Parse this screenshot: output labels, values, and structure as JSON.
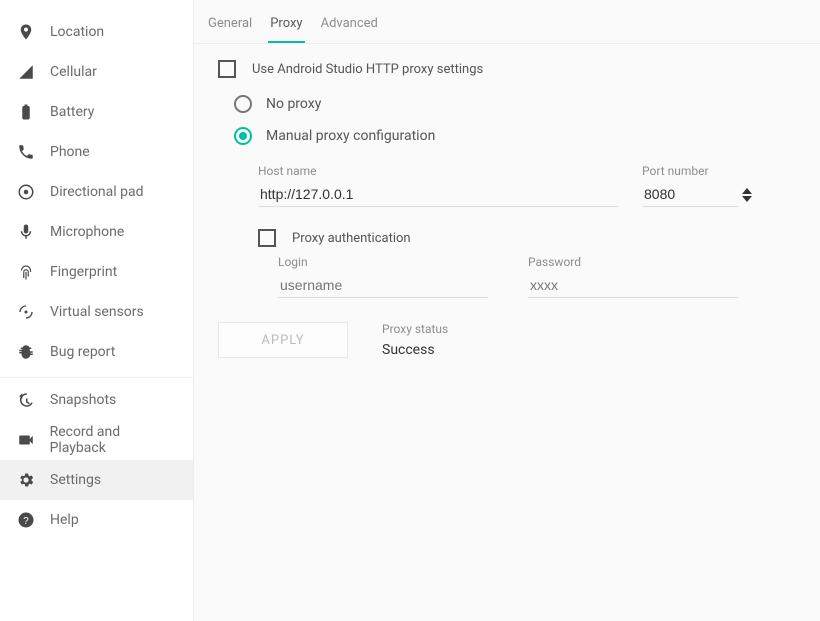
{
  "sidebar": {
    "items": [
      {
        "label": "Location"
      },
      {
        "label": "Cellular"
      },
      {
        "label": "Battery"
      },
      {
        "label": "Phone"
      },
      {
        "label": "Directional pad"
      },
      {
        "label": "Microphone"
      },
      {
        "label": "Fingerprint"
      },
      {
        "label": "Virtual sensors"
      },
      {
        "label": "Bug report"
      }
    ],
    "bottom": [
      {
        "label": "Snapshots"
      },
      {
        "label": "Record and Playback"
      },
      {
        "label": "Settings"
      },
      {
        "label": "Help"
      }
    ]
  },
  "tabs": {
    "general": "General",
    "proxy": "Proxy",
    "advanced": "Advanced"
  },
  "proxy": {
    "use_as_label": "Use Android Studio HTTP proxy settings",
    "no_proxy_label": "No proxy",
    "manual_label": "Manual proxy configuration",
    "hostname_label": "Host name",
    "hostname_value": "http://127.0.0.1",
    "port_label": "Port number",
    "port_value": "8080",
    "auth_label": "Proxy authentication",
    "login_label": "Login",
    "login_placeholder": "username",
    "password_label": "Password",
    "password_placeholder": "xxxx",
    "apply_label": "APPLY",
    "status_label": "Proxy status",
    "status_value": "Success"
  }
}
